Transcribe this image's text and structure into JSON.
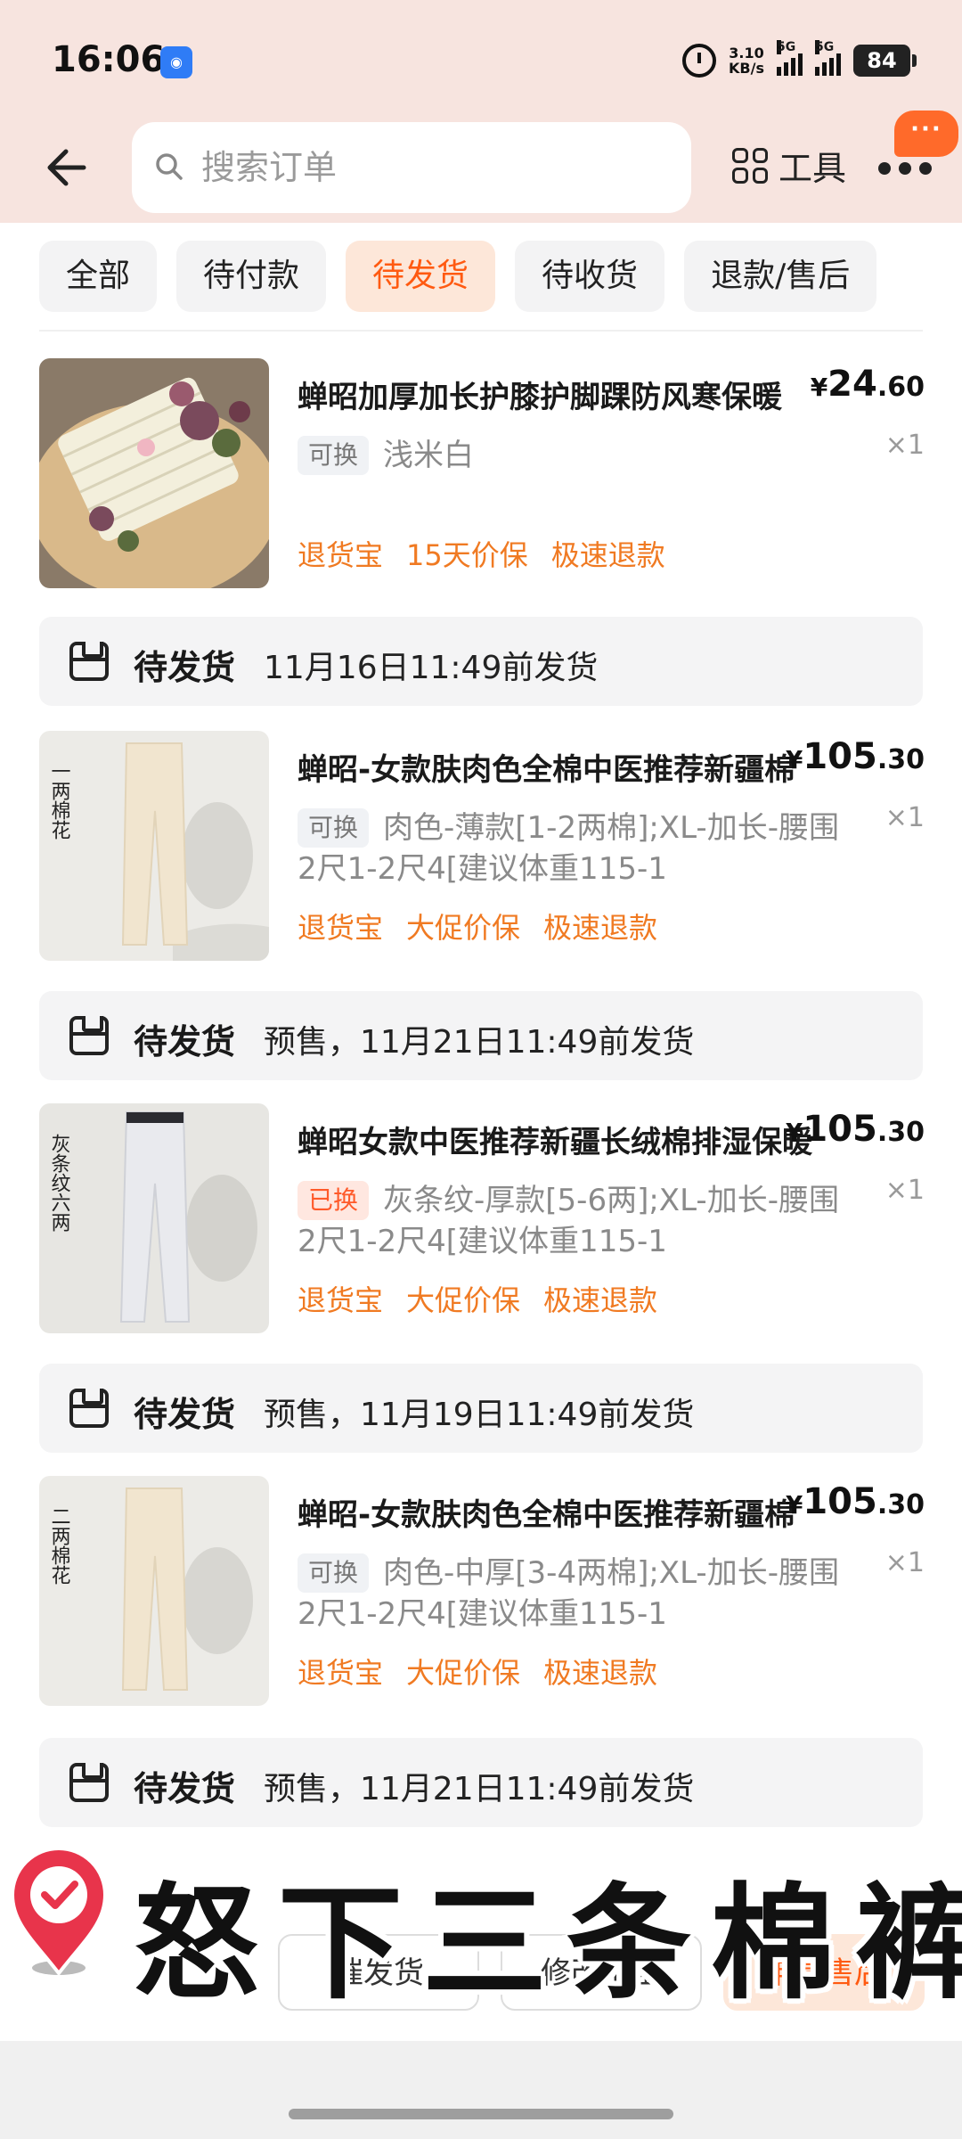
{
  "status_bar": {
    "time": "16:06",
    "speed_value": "3.10",
    "speed_unit": "KB/s",
    "sim1": "5G",
    "sim2": "5G",
    "battery": "84"
  },
  "header": {
    "search_placeholder": "搜索订单",
    "tools_label": "工具",
    "bubble_text": "···"
  },
  "tabs": [
    {
      "label": "全部"
    },
    {
      "label": "待付款"
    },
    {
      "label": "待发货",
      "active": true
    },
    {
      "label": "待收货"
    },
    {
      "label": "退款/售后"
    }
  ],
  "items": [
    {
      "title": "蝉昭加厚加长护膝护脚踝防风寒保暖",
      "price_int": "24",
      "price_dec": ".60",
      "currency": "¥",
      "qty": "×1",
      "chip": "可换",
      "spec": "浅米白",
      "badges": [
        "退货宝",
        "15天价保",
        "极速退款"
      ]
    },
    {
      "title": "蝉昭-女款肤肉色全棉中医推荐新疆棉",
      "price_int": "105",
      "price_dec": ".30",
      "currency": "¥",
      "qty": "×1",
      "chip": "可换",
      "spec": "肉色-薄款[1-2两棉];XL-加长-腰围2尺1-2尺4[建议体重115-1",
      "badges": [
        "退货宝",
        "大促价保",
        "极速退款"
      ],
      "image_text": "一两棉花"
    },
    {
      "title": "蝉昭女款中医推荐新疆长绒棉排湿保暖",
      "price_int": "105",
      "price_dec": ".30",
      "currency": "¥",
      "qty": "×1",
      "chip": "已换",
      "spec": "灰条纹-厚款[5-6两];XL-加长-腰围2尺1-2尺4[建议体重115-1",
      "badges": [
        "退货宝",
        "大促价保",
        "极速退款"
      ],
      "image_text": "灰条纹六两"
    },
    {
      "title": "蝉昭-女款肤肉色全棉中医推荐新疆棉",
      "price_int": "105",
      "price_dec": ".30",
      "currency": "¥",
      "qty": "×1",
      "chip": "可换",
      "spec": "肉色-中厚[3-4两棉];XL-加长-腰围2尺1-2尺4[建议体重115-1",
      "badges": [
        "退货宝",
        "大促价保",
        "极速退款"
      ],
      "image_text": "二两棉花"
    }
  ],
  "shipping": [
    {
      "status": "待发货",
      "desc": "11月16日11:49前发货"
    },
    {
      "status": "待发货",
      "desc": "预售，11月21日11:49前发货"
    },
    {
      "status": "待发货",
      "desc": "预售，11月19日11:49前发货"
    },
    {
      "status": "待发货",
      "desc": "预售，11月21日11:49前发货"
    }
  ],
  "actions": {
    "remind": "催发货",
    "address": "修改地址",
    "aftersale": "申请售后"
  },
  "overlay_caption": "怒下三条棉裤",
  "colors": {
    "accent": "#ff5a11",
    "badge": "#f07a22",
    "header_bg": "#f7e4df"
  }
}
